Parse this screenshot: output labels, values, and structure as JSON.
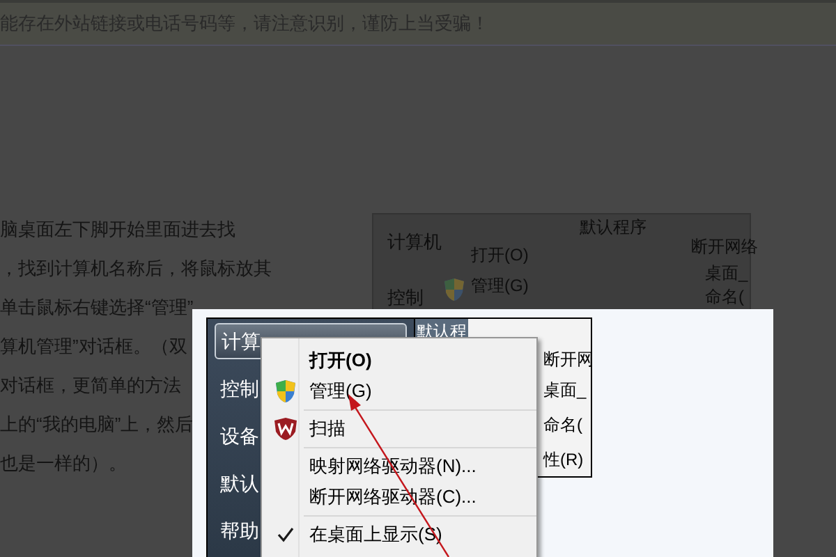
{
  "notice_banner": {
    "text": "能存在外站链接或电话号码等，请注意识别，谨防上当受骗！"
  },
  "article": {
    "lines": [
      "脑桌面左下脚开始里面进去找",
      "，找到计算机名称后，将鼠标放其",
      "单击鼠标右键选择“管理”",
      "算机管理”对话框。（双",
      "对话框，更简单的方法",
      "上的“我的电脑”上，然后",
      "也是一样的）。"
    ]
  },
  "dim_figure": {
    "menu_item": "计算机",
    "menu_item_2": "控制",
    "header": "默认程序",
    "side_top": "断开网络",
    "context_items": [
      "打开(O)",
      "管理(G)"
    ],
    "side_items": [
      "桌面_",
      "命名("
    ]
  },
  "screenshot": {
    "start_menu": {
      "items": [
        {
          "label": "计算",
          "selected": true
        },
        {
          "label": "控制",
          "selected": false
        },
        {
          "label": "设备",
          "selected": false
        },
        {
          "label": "默认",
          "selected": false
        },
        {
          "label": "帮助",
          "selected": false
        }
      ]
    },
    "header": "默认程",
    "side_top": "断开网",
    "side_items": [
      "桌面_",
      "命名(",
      "性(R)"
    ],
    "context_menu": [
      {
        "kind": "text",
        "label": "打开(O)",
        "bold": true,
        "checked": false
      },
      {
        "kind": "shield",
        "label": "管理(G)",
        "bold": false,
        "checked": false
      },
      {
        "kind": "separator"
      },
      {
        "kind": "scan",
        "label": "扫描",
        "bold": false,
        "checked": false
      },
      {
        "kind": "separator"
      },
      {
        "kind": "text",
        "label": "映射网络驱动器(N)...",
        "bold": false,
        "checked": false
      },
      {
        "kind": "text",
        "label": "断开网络驱动器(C)...",
        "bold": false,
        "checked": false
      },
      {
        "kind": "separator"
      },
      {
        "kind": "text",
        "label": "在桌面上显示(S)",
        "bold": false,
        "checked": true
      }
    ]
  }
}
